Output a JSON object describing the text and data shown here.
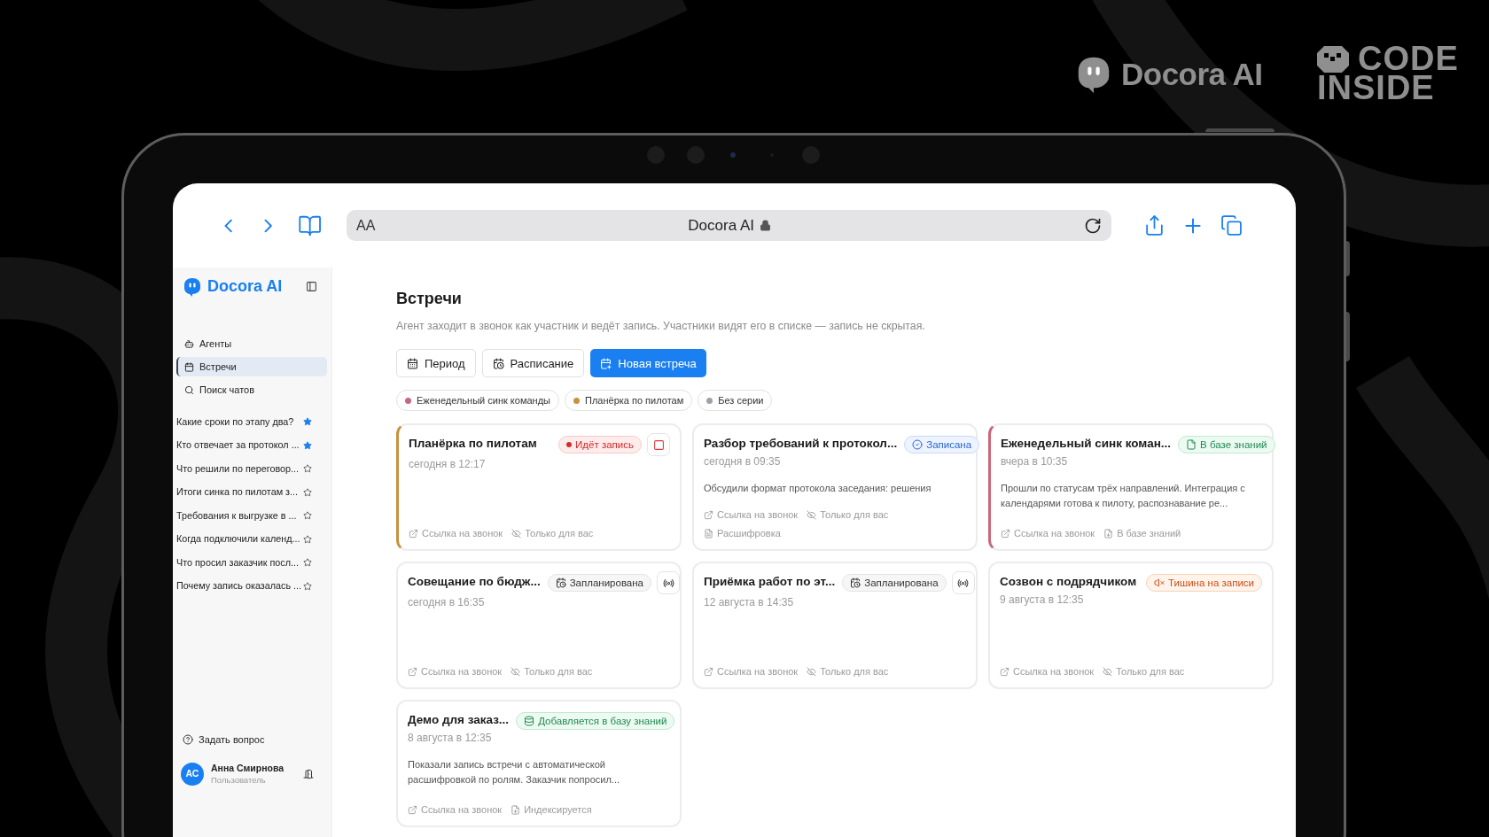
{
  "brand": {
    "name": "Docora AI",
    "studio_line_1": "CODE",
    "studio_line_2": "INSIDE"
  },
  "browser": {
    "text_size": "AA",
    "url": "Docora AI"
  },
  "sidebar": {
    "logo": "Docora AI",
    "nav": [
      {
        "label": "Агенты",
        "selected": false
      },
      {
        "label": "Встречи",
        "selected": true
      },
      {
        "label": "Поиск чатов",
        "selected": false
      }
    ],
    "chats": [
      {
        "title": "Какие сроки по этапу два?",
        "starred": true
      },
      {
        "title": "Кто отвечает за протокол ...",
        "starred": true
      },
      {
        "title": "Что решили по переговор...",
        "starred": false
      },
      {
        "title": "Итоги синка по пилотам з...",
        "starred": false
      },
      {
        "title": "Требования к выгрузке в ...",
        "starred": false
      },
      {
        "title": "Когда подключили календ...",
        "starred": false
      },
      {
        "title": "Что просил заказчик посл...",
        "starred": false
      },
      {
        "title": "Почему запись оказалась ...",
        "starred": false
      }
    ],
    "help": "Задать вопрос",
    "user": {
      "initials": "АС",
      "name": "Анна Смирнова",
      "role": "Пользователь"
    }
  },
  "page": {
    "title": "Встречи",
    "description": "Агент заходит в звонок как участник и ведёт запись. Участники видят его в списке — запись не скрытая.",
    "buttons": [
      {
        "label": "Период",
        "primary": false
      },
      {
        "label": "Расписание",
        "primary": false
      },
      {
        "label": "Новая встреча",
        "primary": true
      }
    ],
    "filters": [
      {
        "label": "Еженедельный синк команды",
        "color": "#c9677a"
      },
      {
        "label": "Планёрка по пилотам",
        "color": "#c8913f"
      },
      {
        "label": "Без серии",
        "color": "#a0a0a8"
      }
    ],
    "meetings": [
      {
        "title": "Планёрка по пилотам",
        "time": "сегодня в 12:17",
        "color": "#c8913f",
        "status": {
          "label": "Идёт запись",
          "kind": "recording"
        },
        "link_rows": [
          [
            {
              "label": "Ссылка на звонок",
              "kind": "link"
            },
            {
              "label": "Только для вас",
              "kind": "private"
            }
          ]
        ]
      },
      {
        "title": "Разбор требований к протокол...",
        "time": "сегодня в 09:35",
        "status": {
          "label": "Записана",
          "kind": "recorded"
        },
        "summary": "Обсудили формат протокола заседания: решения",
        "link_rows": [
          [
            {
              "label": "Ссылка на звонок",
              "kind": "link"
            },
            {
              "label": "Только для вас",
              "kind": "private"
            }
          ],
          [
            {
              "label": "Расшифровка",
              "kind": "transcript"
            }
          ]
        ]
      },
      {
        "title": "Еженедельный синк коман...",
        "time": "вчера в 10:35",
        "color": "#c9677a",
        "status": {
          "label": "В базе знаний",
          "kind": "knowledge"
        },
        "summary": "Прошли по статусам трёх направлений. Интеграция с календарями готова к пилоту, распознавание ре...",
        "link_rows": [
          [
            {
              "label": "Ссылка на звонок",
              "kind": "link"
            },
            {
              "label": "В базе знаний",
              "kind": "kb"
            }
          ]
        ]
      },
      {
        "title": "Совещание по бюдж...",
        "time": "сегодня в 16:35",
        "status": {
          "label": "Запланирована",
          "kind": "scheduled"
        },
        "link_rows": [
          [
            {
              "label": "Ссылка на звонок",
              "kind": "link"
            },
            {
              "label": "Только для вас",
              "kind": "private"
            }
          ]
        ]
      },
      {
        "title": "Приёмка работ по эт...",
        "time": "12 августа в 14:35",
        "status": {
          "label": "Запланирована",
          "kind": "scheduled"
        },
        "link_rows": [
          [
            {
              "label": "Ссылка на звонок",
              "kind": "link"
            },
            {
              "label": "Только для вас",
              "kind": "private"
            }
          ]
        ]
      },
      {
        "title": "Созвон с подрядчиком",
        "time": "9 августа в 12:35",
        "status": {
          "label": "Тишина на записи",
          "kind": "silence"
        },
        "link_rows": [
          [
            {
              "label": "Ссылка на звонок",
              "kind": "link"
            },
            {
              "label": "Только для вас",
              "kind": "private"
            }
          ]
        ]
      },
      {
        "title": "Демо для заказ...",
        "time": "8 августа в 12:35",
        "status": {
          "label": "Добавляется в базу знаний",
          "kind": "indexing"
        },
        "summary": "Показали запись встречи с автоматической расшифровкой по ролям. Заказчик попросил...",
        "link_rows": [
          [
            {
              "label": "Ссылка на звонок",
              "kind": "link"
            },
            {
              "label": "Индексируется",
              "kind": "kb"
            }
          ]
        ]
      }
    ]
  }
}
